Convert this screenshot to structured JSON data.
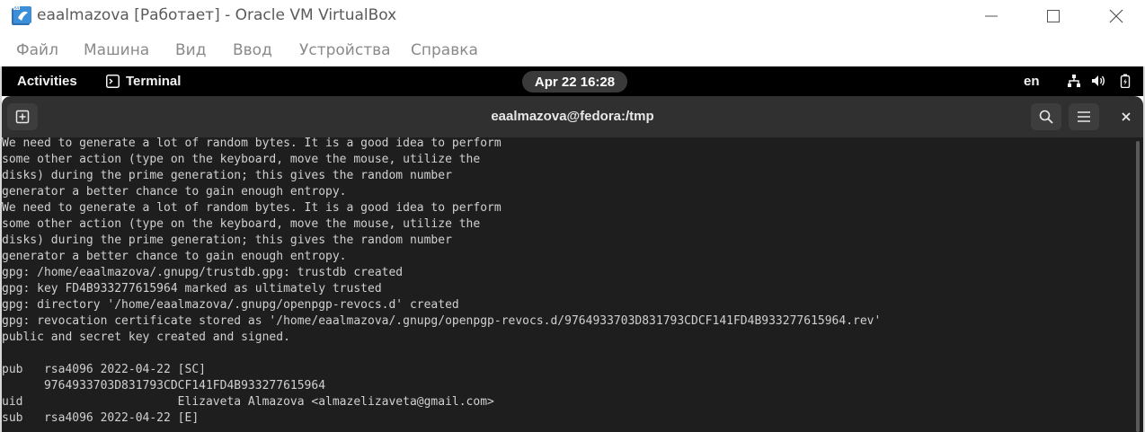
{
  "window": {
    "title": "eaalmazova [Работает] - Oracle VM VirtualBox",
    "icon": "virtualbox-logo-icon"
  },
  "vbox_menu": {
    "items": [
      {
        "label": "Файл"
      },
      {
        "label": "Машина"
      },
      {
        "label": "Вид"
      },
      {
        "label": "Ввод"
      },
      {
        "label": "Устройства"
      },
      {
        "label": "Справка"
      }
    ]
  },
  "gnome_bar": {
    "activities": "Activities",
    "app_name": "Terminal",
    "clock": "Apr 22  16:28",
    "language": "en",
    "tray_icons": [
      "network-icon",
      "volume-icon",
      "battery-icon"
    ]
  },
  "terminal": {
    "title": "eaalmazova@fedora:/tmp",
    "lines": [
      "We need to generate a lot of random bytes. It is a good idea to perform",
      "some other action (type on the keyboard, move the mouse, utilize the",
      "disks) during the prime generation; this gives the random number",
      "generator a better chance to gain enough entropy.",
      "We need to generate a lot of random bytes. It is a good idea to perform",
      "some other action (type on the keyboard, move the mouse, utilize the",
      "disks) during the prime generation; this gives the random number",
      "generator a better chance to gain enough entropy.",
      "gpg: /home/eaalmazova/.gnupg/trustdb.gpg: trustdb created",
      "gpg: key FD4B933277615964 marked as ultimately trusted",
      "gpg: directory '/home/eaalmazova/.gnupg/openpgp-revocs.d' created",
      "gpg: revocation certificate stored as '/home/eaalmazova/.gnupg/openpgp-revocs.d/9764933703D831793CDCF141FD4B933277615964.rev'",
      "public and secret key created and signed.",
      "",
      "pub   rsa4096 2022-04-22 [SC]",
      "      9764933703D831793CDCF141FD4B933277615964",
      "uid                      Elizaveta Almazova <almazelizaveta@gmail.com>",
      "sub   rsa4096 2022-04-22 [E]"
    ]
  },
  "colors": {
    "terminal_bg": "#1e1e1e",
    "terminal_header": "#303030",
    "terminal_text": "#d0d0d0",
    "gnome_bar": "#000000"
  }
}
